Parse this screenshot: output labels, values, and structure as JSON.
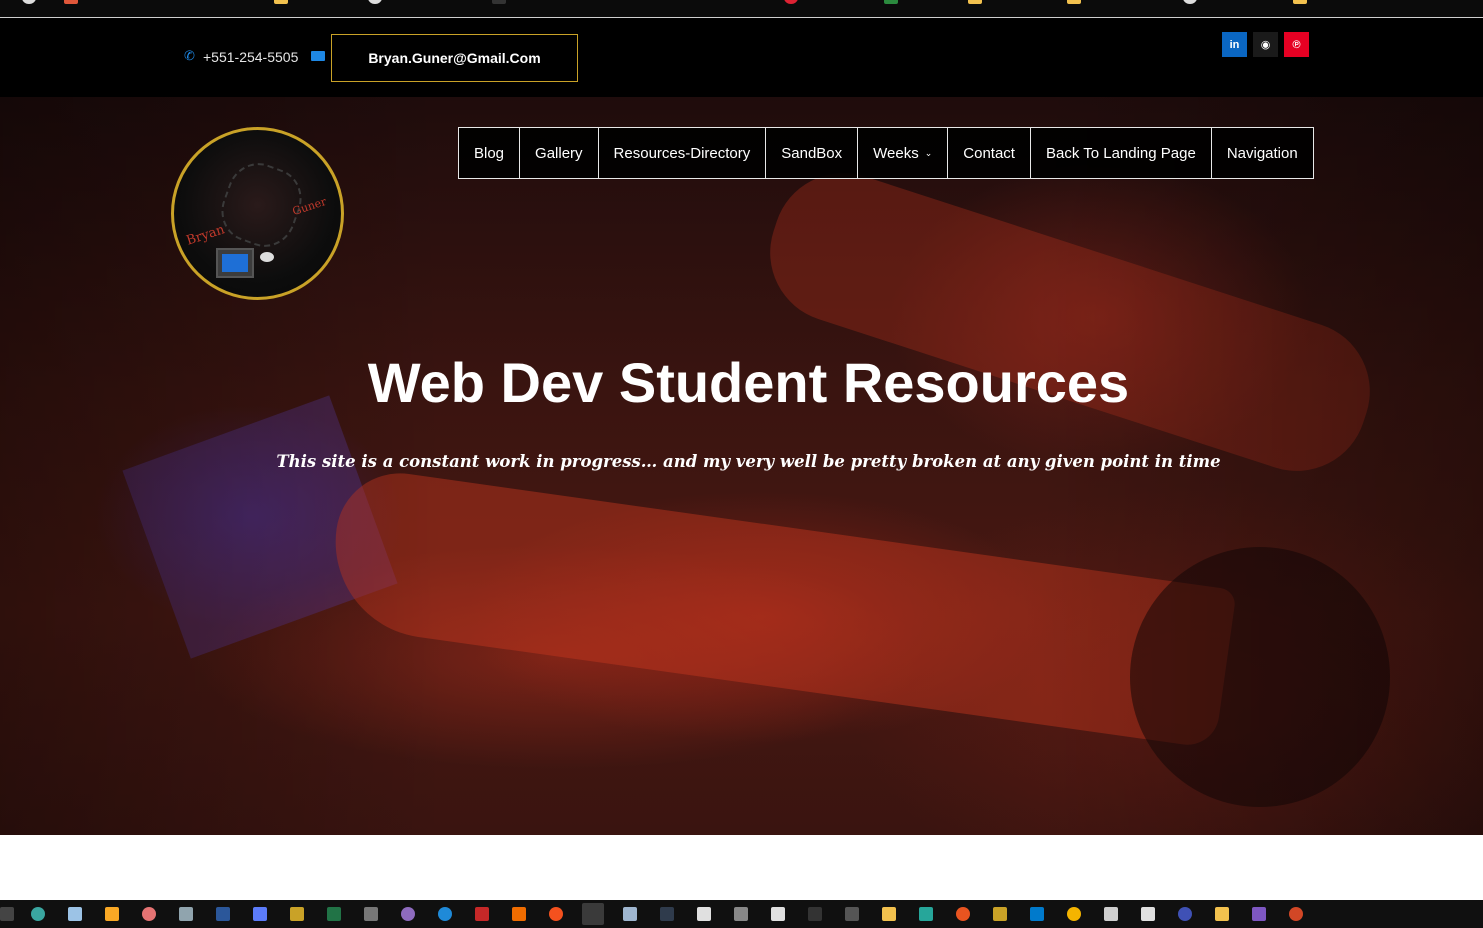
{
  "colors": {
    "topbar_bg": "#000000",
    "accent_gold": "#c9a227",
    "icon_blue": "#1e88e5",
    "linkedin": "#0a66c2",
    "github": "#1a1a1a",
    "pinterest": "#e60023"
  },
  "topbar": {
    "phone": "+551-254-5505",
    "email": "Bryan.Guner@Gmail.Com",
    "social": [
      {
        "name": "linkedin-icon",
        "glyph": "in"
      },
      {
        "name": "github-icon",
        "glyph": "◉"
      },
      {
        "name": "pinterest-icon",
        "glyph": "℗"
      }
    ]
  },
  "logo": {
    "first_name": "Bryan",
    "last_name": "Guner"
  },
  "nav": {
    "items": [
      "Blog",
      "Gallery",
      "Resources-Directory",
      "SandBox",
      "Weeks",
      "Contact",
      "Back To Landing Page",
      "Navigation"
    ],
    "weeks_chevron": "⌄"
  },
  "hero": {
    "title": "Web Dev Student Resources",
    "subtitle": "This site is a constant work in progress… and my very well be pretty broken at any given point in time"
  }
}
